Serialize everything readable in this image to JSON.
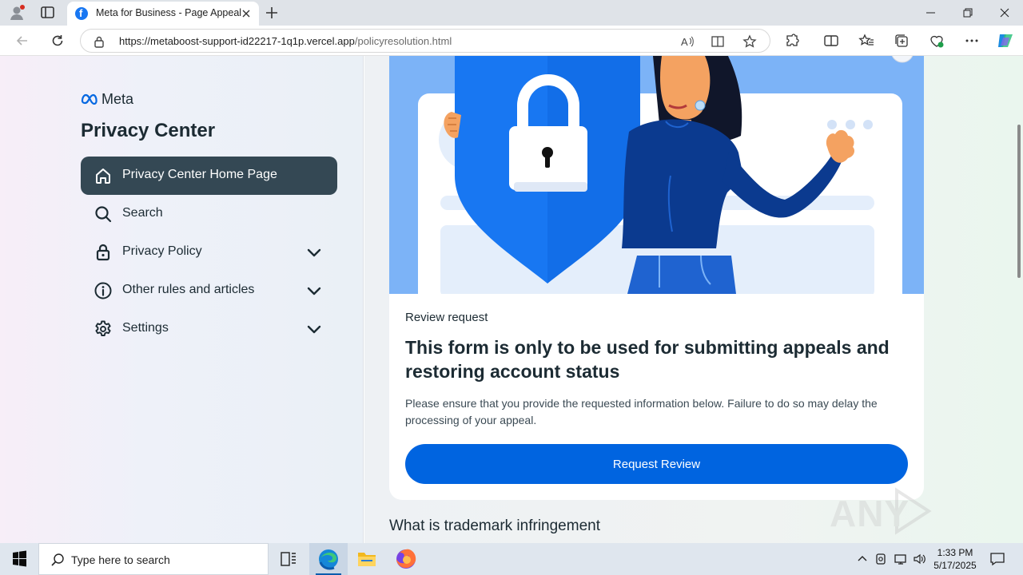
{
  "browser": {
    "tab": {
      "title": "Meta for Business - Page Appeal"
    },
    "address": {
      "domain": "https://metaboost-support-id22217-1q1p.vercel.app",
      "path": "/policyresolution.html"
    }
  },
  "sidebar": {
    "brand": "Meta",
    "title": "Privacy Center",
    "items": [
      {
        "label": "Privacy Center Home Page",
        "icon": "home-icon",
        "active": true,
        "expandable": false
      },
      {
        "label": "Search",
        "icon": "search-icon",
        "active": false,
        "expandable": false
      },
      {
        "label": "Privacy Policy",
        "icon": "lock-icon",
        "active": false,
        "expandable": true
      },
      {
        "label": "Other rules and articles",
        "icon": "info-icon",
        "active": false,
        "expandable": true
      },
      {
        "label": "Settings",
        "icon": "gear-icon",
        "active": false,
        "expandable": true
      }
    ]
  },
  "main": {
    "eyebrow": "Review request",
    "headline": "This form is only to be used for submitting appeals and restoring account status",
    "description": "Please ensure that you provide the requested information below. Failure to do so may delay the processing of your appeal.",
    "cta": "Request Review",
    "next_heading": "What is trademark infringement"
  },
  "watermark": "ANY RUN",
  "taskbar": {
    "search_placeholder": "Type here to search",
    "time": "1:33 PM",
    "date": "5/17/2025"
  },
  "colors": {
    "accent": "#0064e0",
    "nav_active": "#344854",
    "hero_bg": "#7cb3f7",
    "shield": "#1877f2"
  }
}
